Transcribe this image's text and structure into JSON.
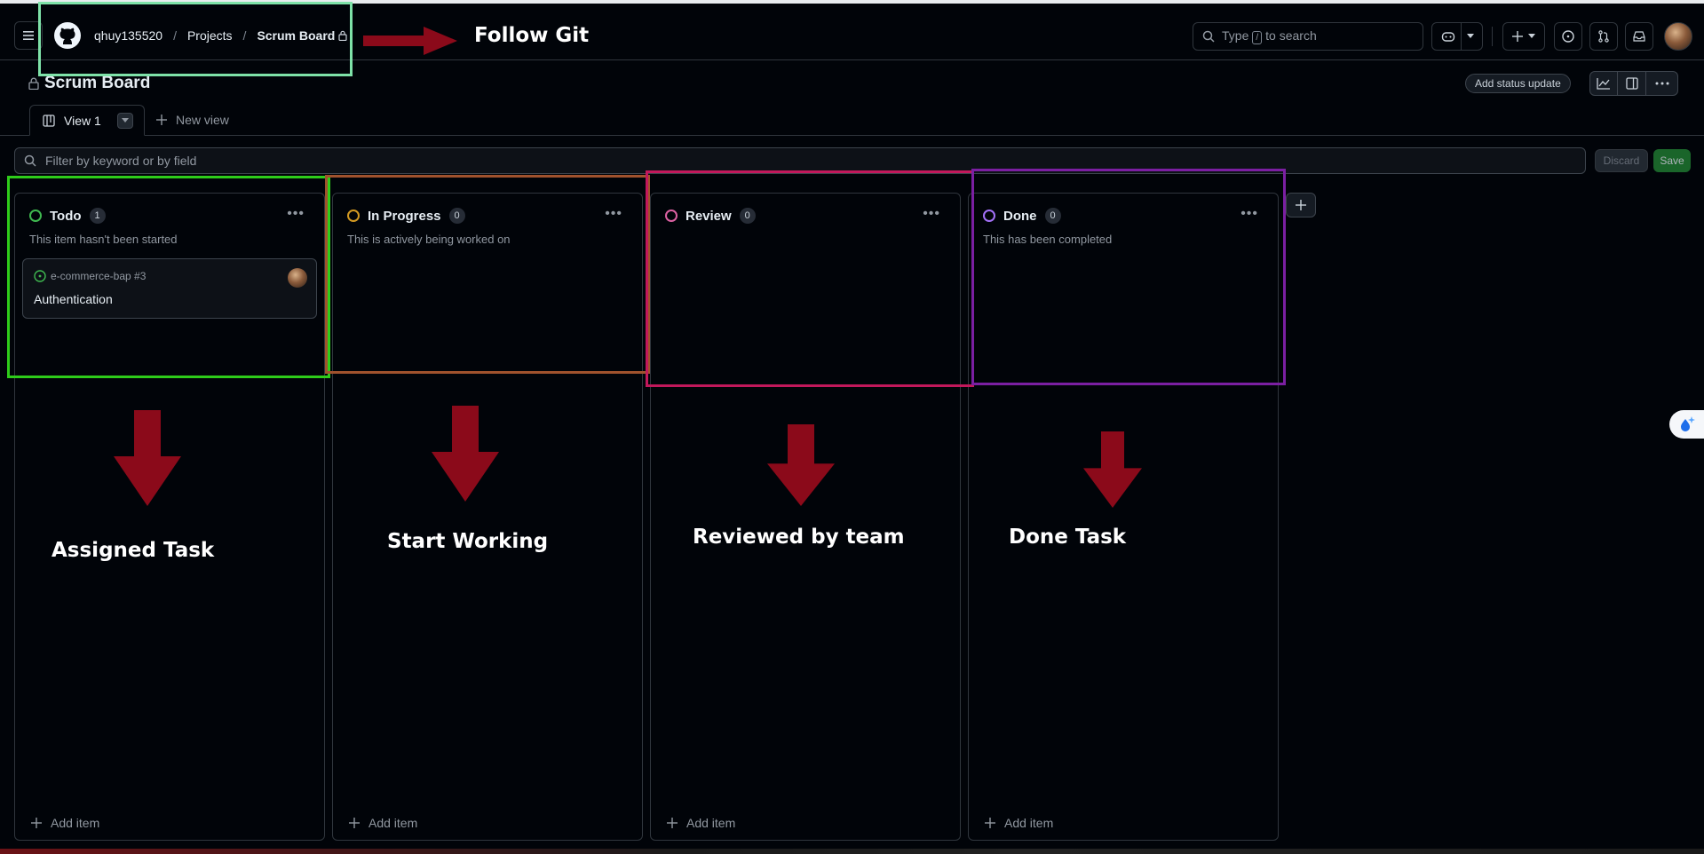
{
  "header": {
    "owner": "qhuy135520",
    "sep": "/",
    "projects": "Projects",
    "project": "Scrum Board",
    "search_prefix": "Type",
    "search_key": "/",
    "search_suffix": "to search"
  },
  "project": {
    "title": "Scrum Board",
    "status_update": "Add status update"
  },
  "views": {
    "active": "View 1",
    "new_view": "New view"
  },
  "filter": {
    "placeholder": "Filter by keyword or by field",
    "discard": "Discard",
    "save": "Save"
  },
  "columns": [
    {
      "name": "Todo",
      "count": "1",
      "description": "This item hasn't been started",
      "color": "#3fb950",
      "add": "Add item"
    },
    {
      "name": "In Progress",
      "count": "0",
      "description": "This is actively being worked on",
      "color": "#d29922",
      "add": "Add item"
    },
    {
      "name": "Review",
      "count": "0",
      "description": "",
      "color": "#db61a2",
      "add": "Add item"
    },
    {
      "name": "Done",
      "count": "0",
      "description": "This has been completed",
      "color": "#a371f7",
      "add": "Add item"
    }
  ],
  "card": {
    "repo": "e-commerce-bap #3",
    "title": "Authentication"
  },
  "annotations": {
    "follow": "Follow Git",
    "todo": "Assigned Task",
    "progress": "Start Working",
    "review": "Reviewed by team",
    "done": "Done Task",
    "colors": {
      "header_box": "#7ee2a8",
      "todo_box": "#2ecc1a",
      "progress_box": "#a0522d",
      "review_box": "#c2185b",
      "done_box": "#7b1fa2",
      "arrow": "#8b0a1a"
    }
  }
}
